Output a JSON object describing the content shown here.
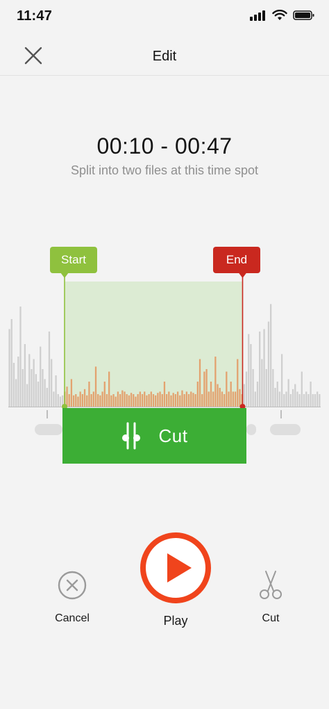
{
  "status_bar": {
    "time": "11:47",
    "icons": [
      "signal-icon",
      "wifi-icon",
      "battery-icon"
    ]
  },
  "header": {
    "title": "Edit",
    "close_icon": "close-icon"
  },
  "selection": {
    "range_text": "00:10 - 00:47",
    "hint": "Split into two files at this time spot",
    "start_label": "Start",
    "end_label": "End",
    "cut_label": "Cut"
  },
  "waveform": {
    "amplitudes": [
      0.62,
      0.7,
      0.35,
      0.22,
      0.4,
      0.8,
      0.3,
      0.5,
      0.18,
      0.42,
      0.3,
      0.38,
      0.26,
      0.2,
      0.48,
      0.3,
      0.22,
      0.15,
      0.6,
      0.38,
      0.12,
      0.25,
      0.1,
      0.08,
      0.09,
      0.12,
      0.16,
      0.1,
      0.22,
      0.09,
      0.1,
      0.08,
      0.12,
      0.1,
      0.14,
      0.09,
      0.2,
      0.1,
      0.12,
      0.32,
      0.1,
      0.09,
      0.12,
      0.2,
      0.1,
      0.28,
      0.09,
      0.1,
      0.08,
      0.12,
      0.1,
      0.13,
      0.12,
      0.1,
      0.09,
      0.11,
      0.1,
      0.08,
      0.1,
      0.12,
      0.1,
      0.12,
      0.09,
      0.1,
      0.12,
      0.1,
      0.09,
      0.11,
      0.12,
      0.1,
      0.2,
      0.1,
      0.12,
      0.09,
      0.11,
      0.1,
      0.12,
      0.09,
      0.13,
      0.1,
      0.12,
      0.1,
      0.12,
      0.11,
      0.1,
      0.2,
      0.38,
      0.1,
      0.28,
      0.3,
      0.12,
      0.2,
      0.12,
      0.4,
      0.18,
      0.15,
      0.12,
      0.1,
      0.28,
      0.12,
      0.2,
      0.12,
      0.12,
      0.38,
      0.14,
      0.1,
      0.18,
      0.28,
      0.58,
      0.5,
      0.3,
      0.12,
      0.2,
      0.6,
      0.38,
      0.62,
      0.3,
      0.68,
      0.82,
      0.3,
      0.15,
      0.2,
      0.12,
      0.42,
      0.1,
      0.12,
      0.22,
      0.1,
      0.14,
      0.18,
      0.12,
      0.1,
      0.28,
      0.1,
      0.12,
      0.1,
      0.2,
      0.1,
      0.1,
      0.12,
      0.1
    ],
    "highlight_start": 0.18,
    "highlight_end": 0.75,
    "colors": {
      "bar": "#cfcfcf",
      "bar_selected": "#e3a26f",
      "selection_bg": "#dcebd3",
      "start_line": "#8fc13e",
      "end_line": "#c9281f"
    }
  },
  "controls": {
    "cancel_label": "Cancel",
    "play_label": "Play",
    "cut_label": "Cut",
    "accent": "#f0441c"
  }
}
